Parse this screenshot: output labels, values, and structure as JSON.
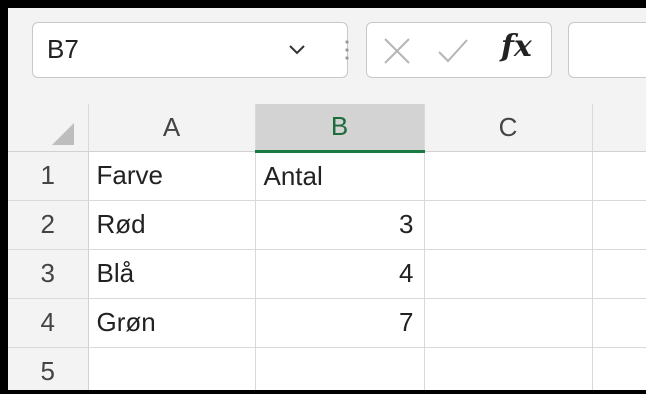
{
  "formula_bar": {
    "name_box": "B7",
    "fx_label": "fx",
    "formula_value": ""
  },
  "columns": [
    "A",
    "B",
    "C"
  ],
  "selected_column": "B",
  "rows": [
    {
      "header": "1",
      "a": "Farve",
      "b": "Antal",
      "c": ""
    },
    {
      "header": "2",
      "a": "Rød",
      "b": "3",
      "c": ""
    },
    {
      "header": "3",
      "a": "Blå",
      "b": "4",
      "c": ""
    },
    {
      "header": "4",
      "a": "Grøn",
      "b": "7",
      "c": ""
    },
    {
      "header": "5",
      "a": "",
      "b": "",
      "c": ""
    }
  ],
  "colors": {
    "selected_header_text": "#1e6b3b",
    "selected_header_underline": "#1a7a43",
    "header_bg": "#f3f3f3",
    "selected_header_bg": "#d3d3d3"
  }
}
